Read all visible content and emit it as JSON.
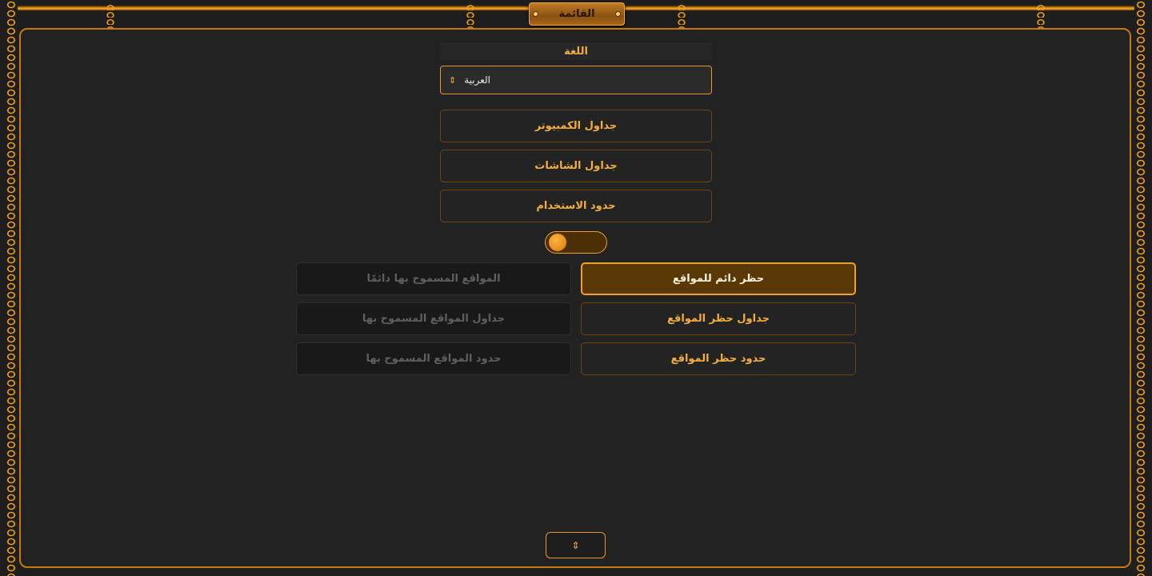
{
  "header": {
    "menu_label": "القائمة"
  },
  "language": {
    "label": "اللغة",
    "selected": "العربية",
    "arrow": "⇕"
  },
  "menu_buttons": {
    "computer_schedules": "جداول الكمبيوتر",
    "screen_schedules": "جداول الشاشات",
    "usage_limits": "حدود الاستخدام"
  },
  "toggle": {
    "state": "off"
  },
  "site_blocking": {
    "permanent_block": "حظر دائم للمواقع",
    "block_schedules": "جداول حظر المواقع",
    "block_limits": "حدود حظر المواقع"
  },
  "site_allowing": {
    "always_allowed": "المواقع المسموح بها دائمًا",
    "allowed_schedules": "جداول المواقع المسموح بها",
    "allowed_limits": "حدود المواقع المسموح بها"
  },
  "footer": {
    "up_icon": "⇕"
  },
  "colors": {
    "accent": "#f5ad3a",
    "border": "#c6780f",
    "background": "#1e1e1e",
    "active_button": "#5a3805"
  }
}
